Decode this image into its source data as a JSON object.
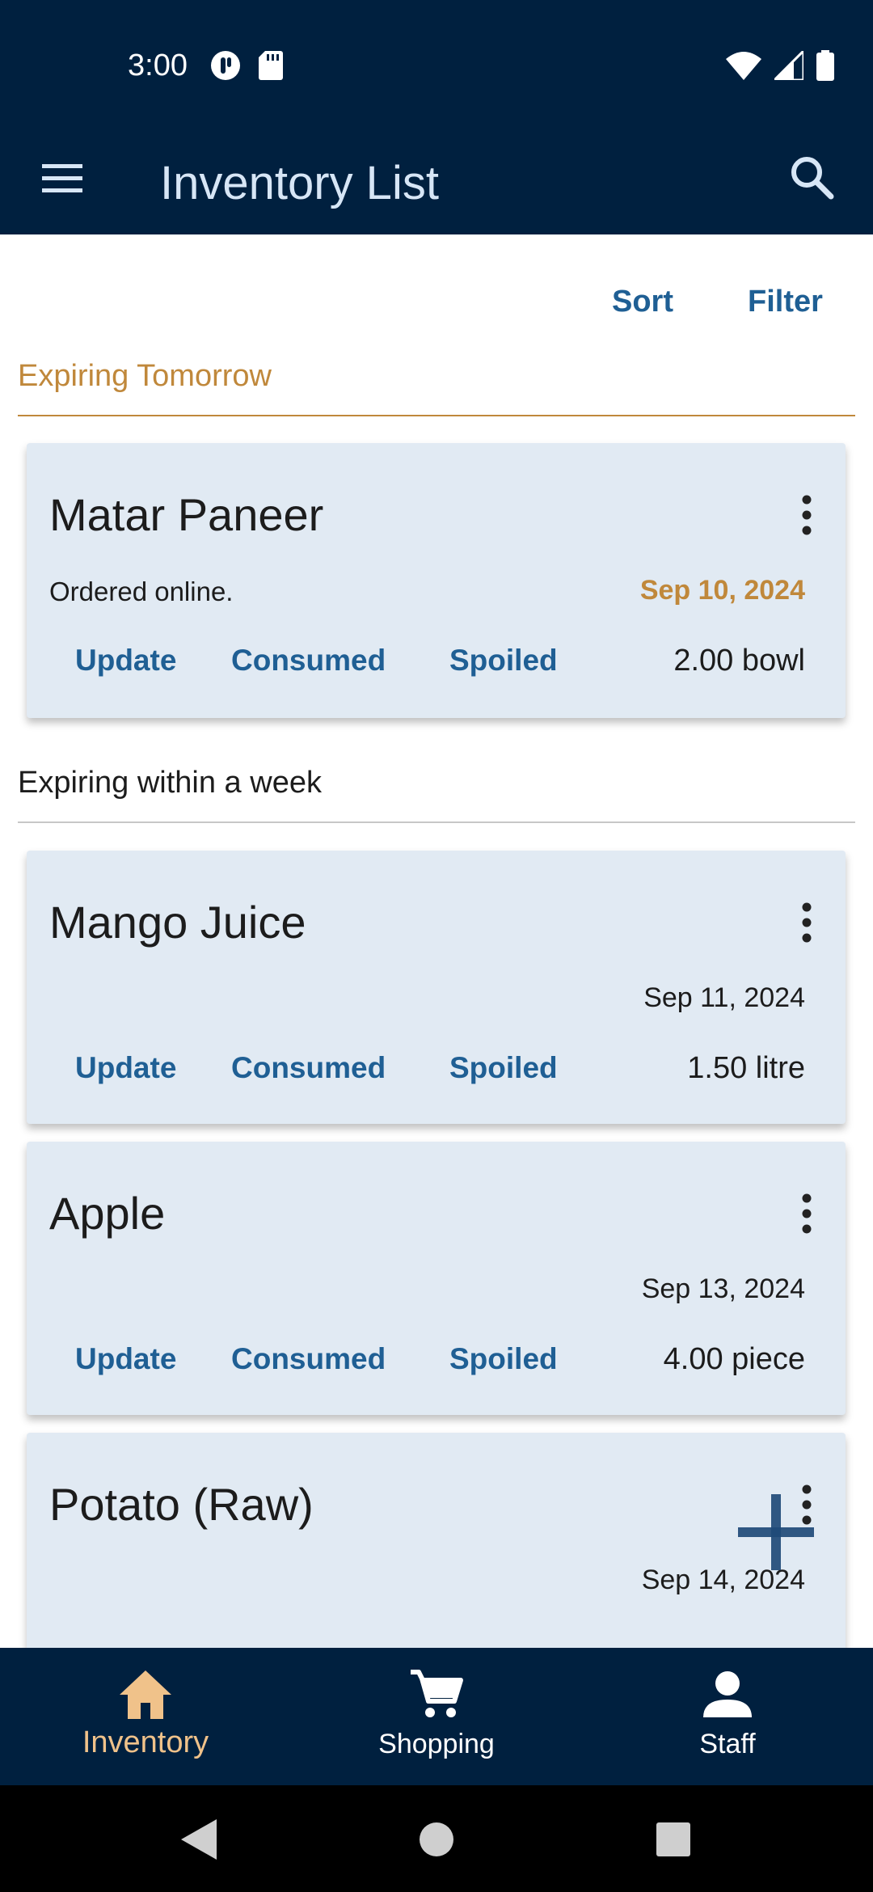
{
  "status_bar": {
    "time": "3:00"
  },
  "app_bar": {
    "title": "Inventory List"
  },
  "toolbar": {
    "sort_label": "Sort",
    "filter_label": "Filter"
  },
  "sections": [
    {
      "label": "Expiring Tomorrow",
      "color": "#c0883b",
      "items": [
        {
          "name": "Matar Paneer",
          "note": "Ordered online.",
          "date": "Sep 10, 2024",
          "quantity": "2.00 bowl"
        }
      ]
    },
    {
      "label": "Expiring within a week",
      "color": "#1c1c1c",
      "items": [
        {
          "name": "Mango Juice",
          "note": "",
          "date": "Sep 11, 2024",
          "quantity": "1.50 litre"
        },
        {
          "name": "Apple",
          "note": "",
          "date": "Sep 13, 2024",
          "quantity": "4.00 piece"
        },
        {
          "name": "Potato (Raw)",
          "note": "",
          "date": "Sep 14, 2024",
          "quantity": ""
        }
      ]
    }
  ],
  "card_actions": {
    "update": "Update",
    "consumed": "Consumed",
    "spoiled": "Spoiled"
  },
  "bottom_nav": [
    {
      "label": "Inventory",
      "icon": "home-icon",
      "active": true
    },
    {
      "label": "Shopping",
      "icon": "cart-icon",
      "active": false
    },
    {
      "label": "Staff",
      "icon": "person-icon",
      "active": false
    }
  ],
  "colors": {
    "primary_dark": "#00203f",
    "accent": "#1f5f94",
    "warning": "#c0883b",
    "card_bg": "#e1eaf3",
    "nav_active": "#f0c28a"
  }
}
